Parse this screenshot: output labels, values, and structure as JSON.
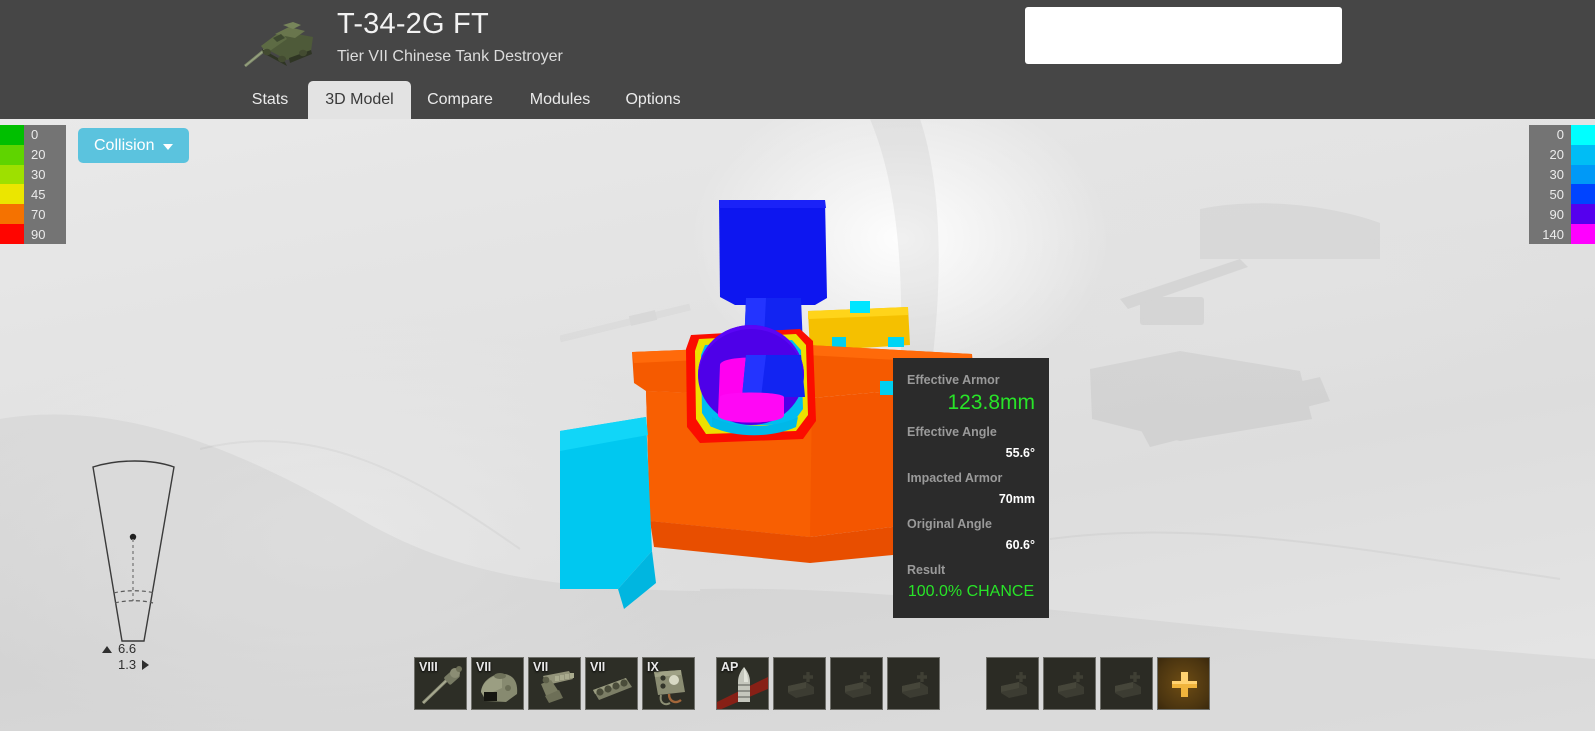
{
  "header": {
    "title": "T-34-2G FT",
    "subtitle": "Tier VII Chinese Tank Destroyer",
    "search_value": "",
    "search_placeholder": ""
  },
  "nav": {
    "tabs": [
      {
        "label": "Stats",
        "active": false
      },
      {
        "label": "3D Model",
        "active": true
      },
      {
        "label": "Compare",
        "active": false
      },
      {
        "label": "Modules",
        "active": false
      },
      {
        "label": "Options",
        "active": false
      }
    ]
  },
  "toolbar": {
    "collision_label": "Collision"
  },
  "legend_left": {
    "title": "armor-thickness-scale",
    "entries": [
      {
        "label": "0",
        "color": "#00bf00"
      },
      {
        "label": "20",
        "color": "#5fd400"
      },
      {
        "label": "30",
        "color": "#9ee000"
      },
      {
        "label": "45",
        "color": "#ebe600"
      },
      {
        "label": "70",
        "color": "#f57200"
      },
      {
        "label": "90",
        "color": "#ff0500"
      }
    ]
  },
  "legend_right": {
    "title": "module-armor-scale",
    "entries": [
      {
        "label": "0",
        "color": "#00ffff"
      },
      {
        "label": "20",
        "color": "#00bdf5"
      },
      {
        "label": "30",
        "color": "#0099f7"
      },
      {
        "label": "50",
        "color": "#0044ff"
      },
      {
        "label": "90",
        "color": "#5500ee"
      },
      {
        "label": "140",
        "color": "#ff00ff"
      }
    ]
  },
  "traverse": {
    "elevation": "6.6",
    "depression": "1.3"
  },
  "info_panel": {
    "rows": [
      {
        "label": "Effective Armor",
        "value": "123.8mm",
        "style": "big"
      },
      {
        "label": "Effective Angle",
        "value": "55.6°",
        "style": "plain"
      },
      {
        "label": "Impacted Armor",
        "value": "70mm",
        "style": "plain"
      },
      {
        "label": "Original Angle",
        "value": "60.6°",
        "style": "plain"
      },
      {
        "label": "Result",
        "value": "100.0% CHANCE",
        "style": "green"
      }
    ]
  },
  "slots": {
    "modules": [
      {
        "tier": "VIII",
        "icon": "gun-icon"
      },
      {
        "tier": "VII",
        "icon": "turret-icon"
      },
      {
        "tier": "VII",
        "icon": "engine-icon"
      },
      {
        "tier": "VII",
        "icon": "tracks-icon"
      },
      {
        "tier": "IX",
        "icon": "radio-icon"
      }
    ],
    "shells": [
      {
        "tier": "AP",
        "icon": "ap-shell-icon"
      },
      {
        "tier": "",
        "icon": "empty-shell-icon"
      },
      {
        "tier": "",
        "icon": "empty-shell-icon"
      },
      {
        "tier": "",
        "icon": "empty-shell-icon"
      }
    ],
    "consumables": [
      {
        "tier": "",
        "icon": "empty-consumable-icon"
      },
      {
        "tier": "",
        "icon": "empty-consumable-icon"
      },
      {
        "tier": "",
        "icon": "empty-consumable-icon"
      },
      {
        "tier": "",
        "icon": "add-premium-icon"
      }
    ]
  },
  "colors": {
    "header_bg": "#464646",
    "viewport_bg": "#e3e3e3",
    "accent": "#5bc3de",
    "tooltip_bg": "#2b2b2b",
    "value_green": "#28e428"
  }
}
